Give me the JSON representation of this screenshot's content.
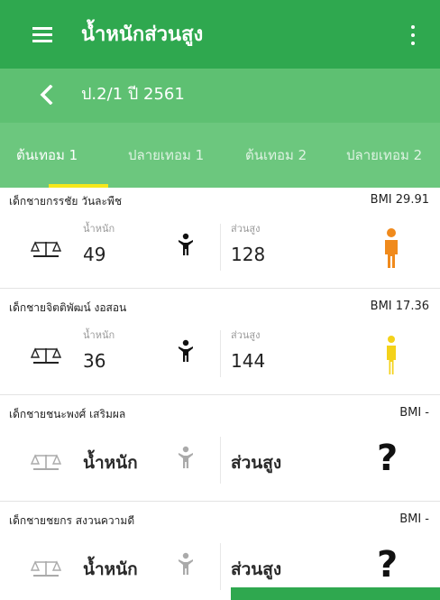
{
  "appbar": {
    "title": "น้ำหนักส่วนสูง",
    "menu_icon": "hamburger-menu-icon",
    "more_icon": "more-vertical-icon"
  },
  "subbar": {
    "back_icon": "chevron-left-icon",
    "subtitle": "ป.2/1 ปี 2561"
  },
  "tabs": [
    {
      "label": "ต้นเทอม 1",
      "active": true
    },
    {
      "label": "ปลายเทอม 1",
      "active": false
    },
    {
      "label": "ต้นเทอม 2",
      "active": false
    },
    {
      "label": "ปลายเทอม 2",
      "active": false
    }
  ],
  "students": [
    {
      "name": "เด็กชายกรรชัย วันละพืช",
      "bmi": "BMI 29.91",
      "weight_label": "น้ำหนัก",
      "weight": "49",
      "height_label": "ส่วนสูง",
      "height": "128",
      "status_color": "#f08a1c"
    },
    {
      "name": "เด็กชายจิตติพัฒน์ งอสอน",
      "bmi": "BMI 17.36",
      "weight_label": "น้ำหนัก",
      "weight": "36",
      "height_label": "ส่วนสูง",
      "height": "144",
      "status_color": "#f4d21a"
    },
    {
      "name": "เด็กชายชนะพงศ์ เสริมผล",
      "bmi": "BMI -",
      "weight_placeholder": "น้ำหนัก",
      "height_placeholder": "ส่วนสูง",
      "status": "?"
    },
    {
      "name": "เด็กชายชยกร สงวนความดี",
      "bmi": "BMI -",
      "weight_placeholder": "น้ำหนัก",
      "height_placeholder": "ส่วนสูง",
      "status": "?"
    }
  ]
}
